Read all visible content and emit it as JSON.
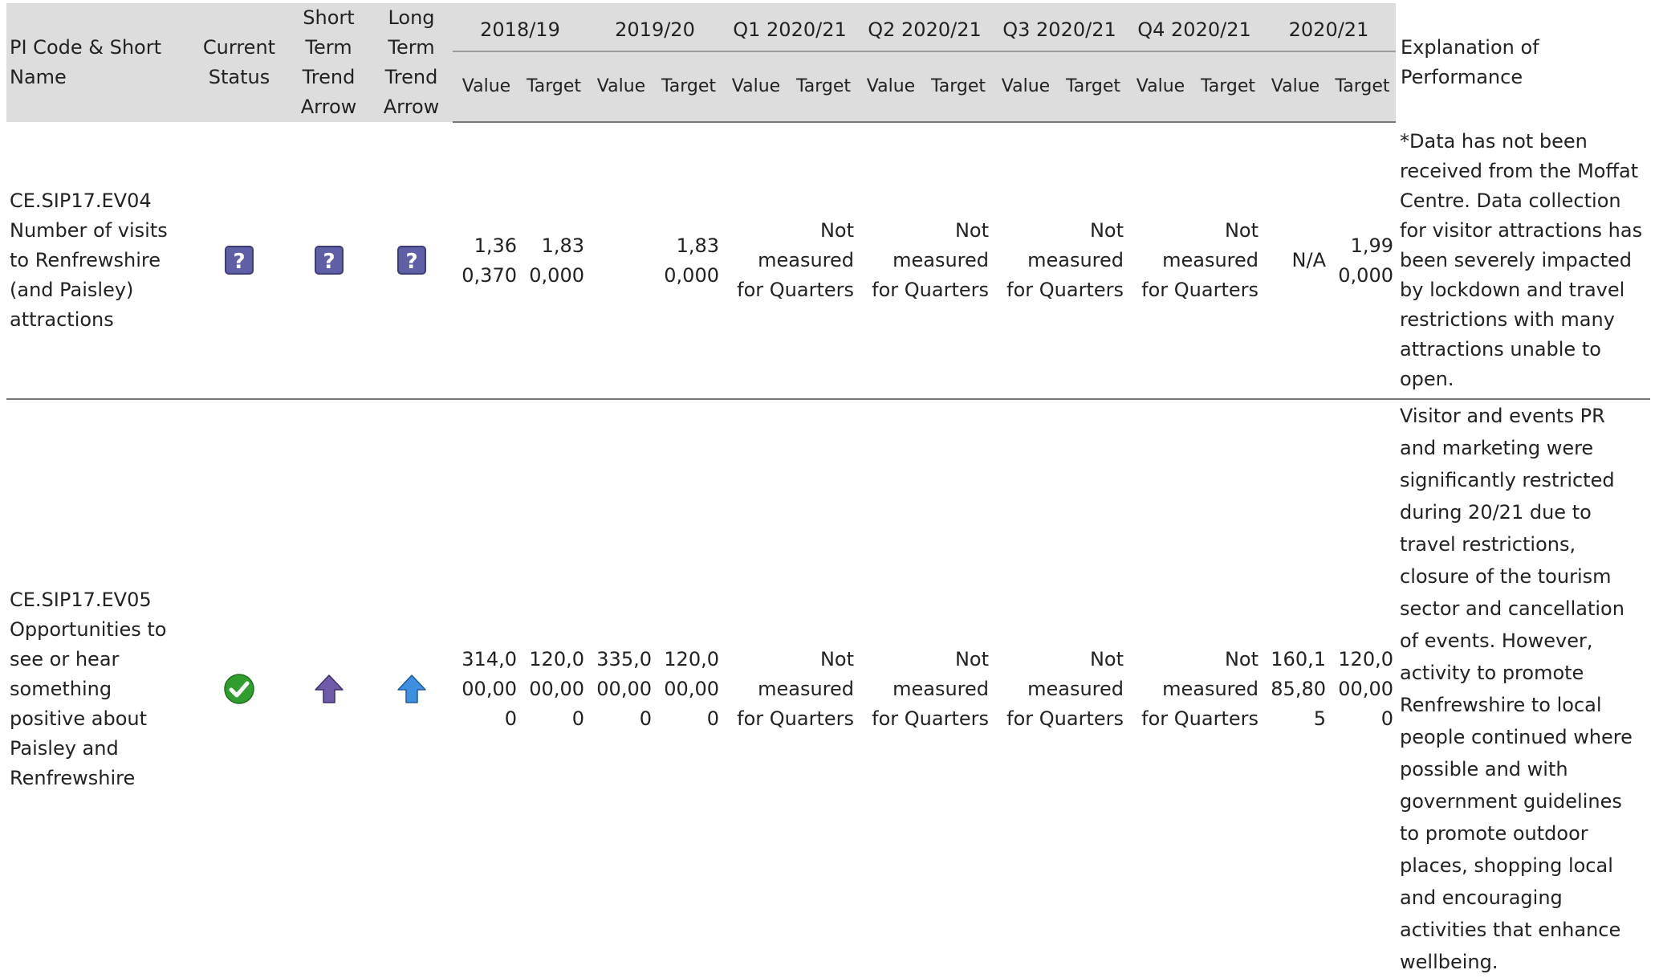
{
  "header": {
    "pi_code": "PI Code & Short Name",
    "current_status": "Current Status",
    "short_term": "Short Term Trend Arrow",
    "long_term": "Long Term Trend Arrow",
    "periods": [
      "2018/19",
      "2019/20",
      "Q1 2020/21",
      "Q2 2020/21",
      "Q3 2020/21",
      "Q4 2020/21",
      "2020/21"
    ],
    "value": "Value",
    "target": "Target",
    "explanation": "Explanation of Performance"
  },
  "rows": [
    {
      "code": "CE.SIP17.EV04",
      "name": "Number of visits to Renfrewshire (and Paisley) attractions",
      "status_icon": "unknown-icon",
      "short_trend_icon": "unknown-icon",
      "long_trend_icon": "unknown-icon",
      "cells": [
        "1,360,370",
        "1,830,000",
        "",
        "1,830,000",
        "Not measured for Quarters",
        "",
        "Not measured for Quarters",
        "",
        "Not measured for Quarters",
        "",
        "Not measured for Quarters",
        "",
        "N/A",
        "1,990,000"
      ],
      "explanation": "*Data has not been received from the Moffat Centre. Data collection for visitor attractions has been severely impacted by lockdown and travel restrictions with many attractions unable to open."
    },
    {
      "code": "CE.SIP17.EV05",
      "name": "Opportunities to see or hear something positive about Paisley and Renfrewshire",
      "status_icon": "green-check-icon",
      "short_trend_icon": "purple-up-arrow-icon",
      "long_trend_icon": "blue-up-arrow-icon",
      "cells": [
        "314,000,000",
        "120,000,000",
        "335,000,000",
        "120,000,000",
        "Not measured for Quarters",
        "",
        "Not measured for Quarters",
        "",
        "Not measured for Quarters",
        "",
        "Not measured for Quarters",
        "",
        "160,185,805",
        "120,000,000"
      ],
      "explanation": "Visitor and events PR and marketing were significantly restricted during 20/21 due to travel restrictions, closure of the tourism sector and cancellation of events. However, activity to promote Renfrewshire to local people continued where possible and with government guidelines to promote outdoor places, shopping local and encouraging activities that enhance wellbeing."
    }
  ],
  "colors": {
    "header_bg": "#dddddd",
    "rule": "#777777",
    "status_ok": "#2f9e2f",
    "trend_purple": "#6e5aa8",
    "trend_blue": "#3e8fe0",
    "unknown_icon": "#5f5fa6"
  }
}
